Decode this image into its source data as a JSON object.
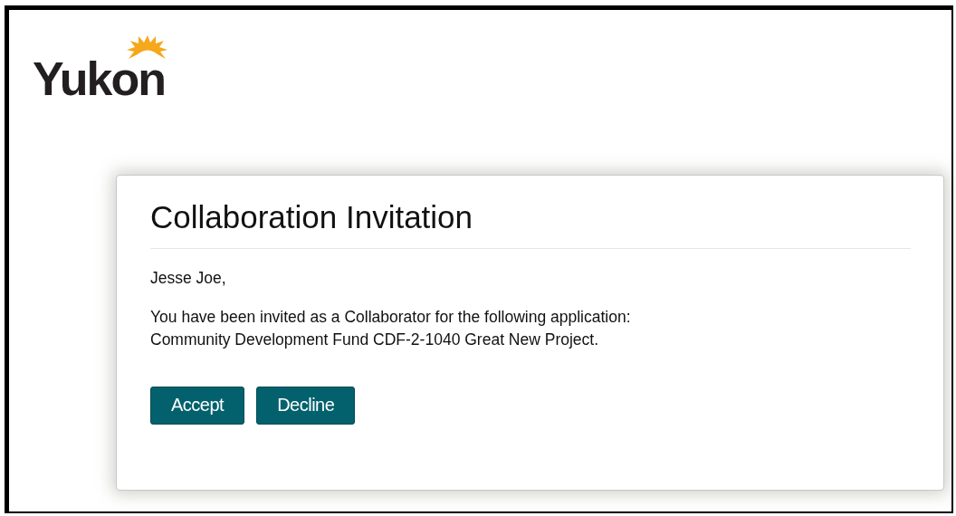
{
  "logo": {
    "text": "Yukon"
  },
  "dialog": {
    "title": "Collaboration Invitation",
    "greeting": "Jesse Joe,",
    "message": [
      "You have been invited as a Collaborator for the following application:",
      "Community Development Fund CDF-2-1040 Great New Project."
    ],
    "buttons": [
      {
        "label": "Accept"
      },
      {
        "label": "Decline"
      }
    ]
  }
}
